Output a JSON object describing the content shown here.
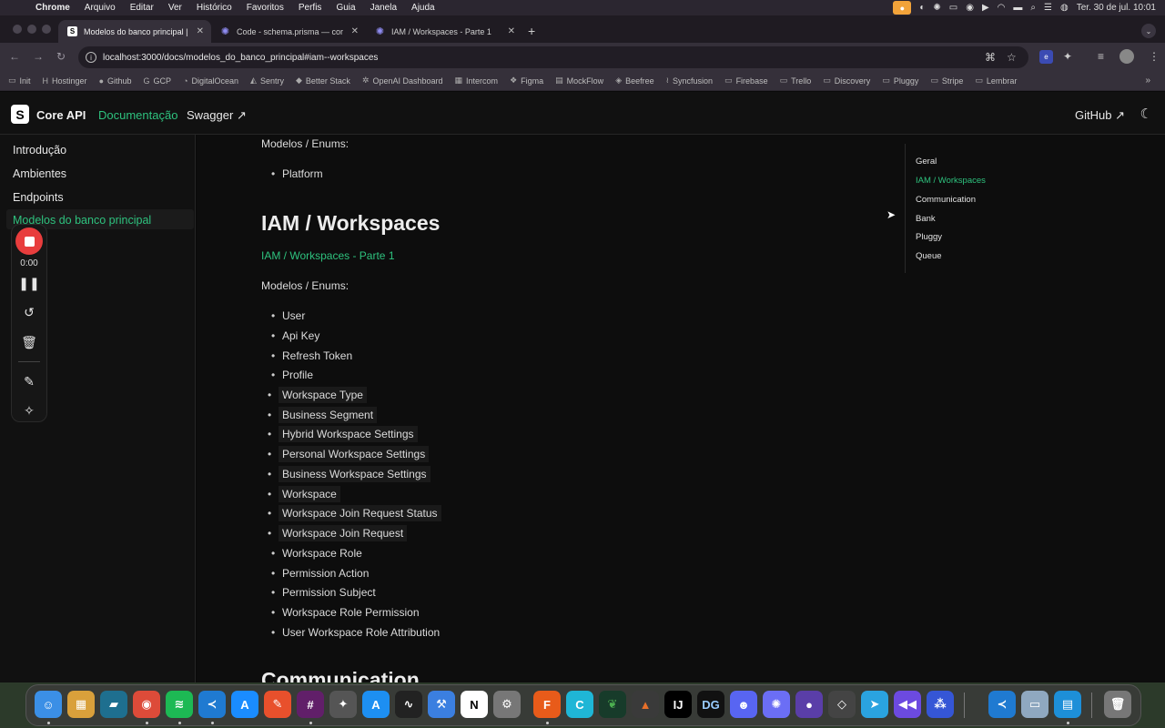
{
  "menubar": {
    "app": "Chrome",
    "items": [
      "Arquivo",
      "Editar",
      "Ver",
      "Histórico",
      "Favoritos",
      "Perfis",
      "Guia",
      "Janela",
      "Ajuda"
    ],
    "datetime": "Ter. 30 de jul.  10:01"
  },
  "tabs": [
    {
      "title": "Modelos do banco principal |",
      "icon": "s-logo-icon",
      "active": true
    },
    {
      "title": "Code - schema.prisma — cor",
      "icon": "gear-icon",
      "active": false
    },
    {
      "title": "IAM / Workspaces - Parte 1",
      "icon": "gear-icon",
      "active": false
    }
  ],
  "url": "localhost:3000/docs/modelos_do_banco_principal#iam--workspaces",
  "bookmarks": [
    "Init",
    "Hostinger",
    "Github",
    "GCP",
    "DigitalOcean",
    "Sentry",
    "Better Stack",
    "OpenAI Dashboard",
    "Intercom",
    "Figma",
    "MockFlow",
    "Beefree",
    "Syncfusion",
    "Firebase",
    "Trello",
    "Discovery",
    "Pluggy",
    "Stripe",
    "Lembrar"
  ],
  "header": {
    "brand": "Core API",
    "nav": [
      "Documentação",
      "Swagger"
    ],
    "github": "GitHub",
    "external_glyph": "↗"
  },
  "sidebar": {
    "items": [
      "Introdução",
      "Ambientes",
      "Endpoints",
      "Modelos do banco principal"
    ]
  },
  "recorder": {
    "time": "0:00"
  },
  "content": {
    "prev_label": "Modelos / Enums:",
    "prev_items": [
      "Platform"
    ],
    "section_title": "IAM / Workspaces",
    "section_link": "IAM / Workspaces - Parte 1",
    "models_label": "Modelos / Enums:",
    "items": [
      {
        "text": "User",
        "code": false
      },
      {
        "text": "Api Key",
        "code": false
      },
      {
        "text": "Refresh Token",
        "code": false
      },
      {
        "text": "Profile",
        "code": false
      },
      {
        "text": "Workspace Type",
        "code": true
      },
      {
        "text": "Business Segment",
        "code": true
      },
      {
        "text": "Hybrid Workspace Settings",
        "code": true
      },
      {
        "text": "Personal Workspace Settings",
        "code": true
      },
      {
        "text": "Business Workspace Settings",
        "code": true
      },
      {
        "text": "Workspace",
        "code": true
      },
      {
        "text": "Workspace Join Request Status",
        "code": true
      },
      {
        "text": "Workspace Join Request",
        "code": true
      },
      {
        "text": "Workspace Role",
        "code": false
      },
      {
        "text": "Permission Action",
        "code": false
      },
      {
        "text": "Permission Subject",
        "code": false
      },
      {
        "text": "Workspace Role Permission",
        "code": false
      },
      {
        "text": "User Workspace Role Attribution",
        "code": false
      }
    ],
    "next_title": "Communication"
  },
  "toc": {
    "items": [
      "Geral",
      "IAM / Workspaces",
      "Communication",
      "Bank",
      "Pluggy",
      "Queue"
    ],
    "active_index": 1
  },
  "colors": {
    "accent": "#2ec27e",
    "record": "#e83d3d"
  }
}
